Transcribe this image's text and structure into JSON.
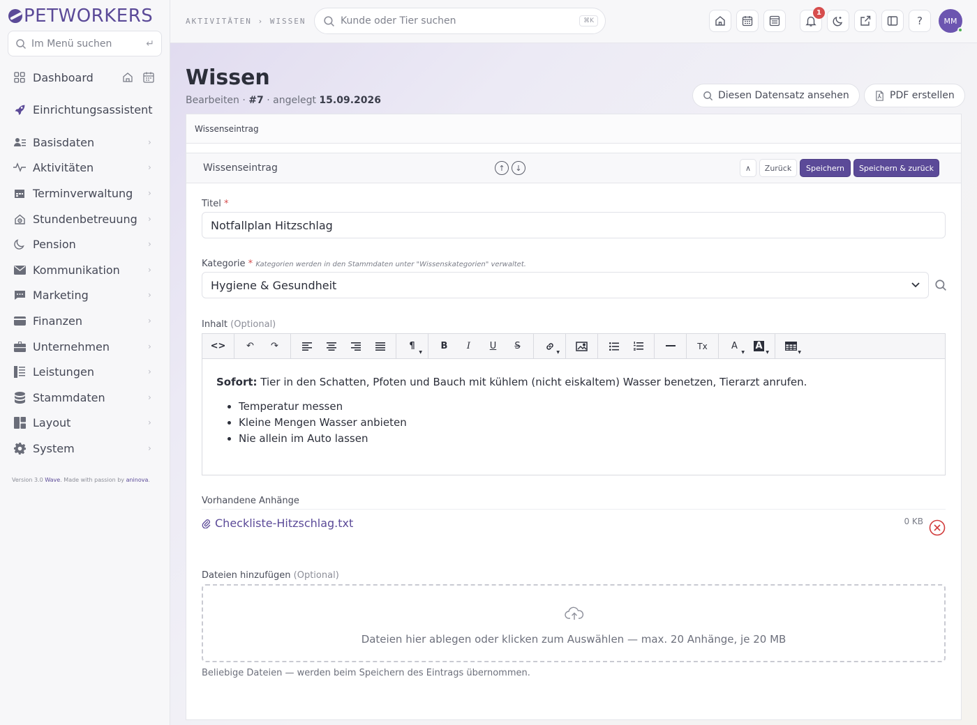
{
  "brand": {
    "name": "PETWORKERS"
  },
  "sidebar": {
    "search_placeholder": "Im Menü suchen",
    "enter_glyph": "↵",
    "items": [
      {
        "label": "Dashboard",
        "icon": "grid-icon"
      },
      {
        "label": "Einrichtungsassistent",
        "icon": "rocket-icon"
      },
      {
        "label": "Basisdaten",
        "icon": "user-list-icon"
      },
      {
        "label": "Aktivitäten",
        "icon": "activity-icon"
      },
      {
        "label": "Terminverwaltung",
        "icon": "calendar-icon"
      },
      {
        "label": "Stundenbetreuung",
        "icon": "house-clock-icon"
      },
      {
        "label": "Pension",
        "icon": "moon-icon"
      },
      {
        "label": "Kommunikation",
        "icon": "mail-icon"
      },
      {
        "label": "Marketing",
        "icon": "chat-icon"
      },
      {
        "label": "Finanzen",
        "icon": "wallet-icon"
      },
      {
        "label": "Unternehmen",
        "icon": "briefcase-icon"
      },
      {
        "label": "Leistungen",
        "icon": "list-icon"
      },
      {
        "label": "Stammdaten",
        "icon": "database-icon"
      },
      {
        "label": "Layout",
        "icon": "layout-icon"
      },
      {
        "label": "System",
        "icon": "gear-icon"
      }
    ],
    "version_prefix": "Version 3.0",
    "version_name": "Wave",
    "version_mid": ". Made with passion by",
    "version_company": "aninova",
    "version_suffix": "."
  },
  "topbar": {
    "breadcrumb": "AKTIVITÄTEN › WISSEN",
    "search_placeholder": "Kunde oder Tier suchen",
    "search_shortcut": "⌘K",
    "notification_count": "1",
    "avatar_initials": "MM",
    "help_label": "?"
  },
  "page": {
    "title": "Wissen",
    "sub_mode": "Bearbeiten",
    "sub_id": "#7",
    "sub_created_label": "angelegt",
    "sub_created_date": "15.09.2026",
    "btn_view": "Diesen Datensatz ansehen",
    "btn_pdf": "PDF erstellen"
  },
  "card": {
    "header": "Wissenseintrag",
    "subheader": "Wissenseintrag",
    "btn_collapse": "∧",
    "btn_back": "Zurück",
    "btn_save": "Speichern",
    "btn_save_back": "Speichern & zurück"
  },
  "form": {
    "title_label": "Titel",
    "title_value": "Notfallplan Hitzschlag",
    "category_label": "Kategorie",
    "category_hint": "Kategorien werden in den Stammdaten unter \"Wissenskategorien\" verwaltet.",
    "category_value": "Hygiene & Gesundheit",
    "content_label": "Inhalt",
    "optional": "(Optional)",
    "required_mark": "*",
    "content_lead_bold": "Sofort:",
    "content_lead_text": " Tier in den Schatten, Pfoten und Bauch mit kühlem (nicht eiskaltem) Wasser benetzen, Tierarzt anrufen.",
    "content_list": [
      "Temperatur messen",
      "Kleine Mengen Wasser anbieten",
      "Nie allein im Auto lassen"
    ],
    "attachments_label": "Vorhandene Anhänge",
    "attachment_name": "Checkliste-Hitzschlag.txt",
    "attachment_size": "0 KB",
    "upload_label": "Dateien hinzufügen",
    "dropzone_text": "Dateien hier ablegen oder klicken zum Auswählen — max. 20 Anhänge, je 20 MB",
    "dropzone_help": "Beliebige Dateien — werden beim Speichern des Eintrags übernommen."
  },
  "toolbar": {
    "source": "<>",
    "undo": "↶",
    "redo": "↷",
    "paragraph": "¶",
    "bold": "B",
    "italic": "I",
    "underline": "U",
    "strike": "S",
    "font_color": "A",
    "bg_color": "A",
    "clear_format": "Tx"
  },
  "colors": {
    "accent": "#5b4a98",
    "danger": "#d13b3b",
    "badge": "#d64d4d"
  }
}
